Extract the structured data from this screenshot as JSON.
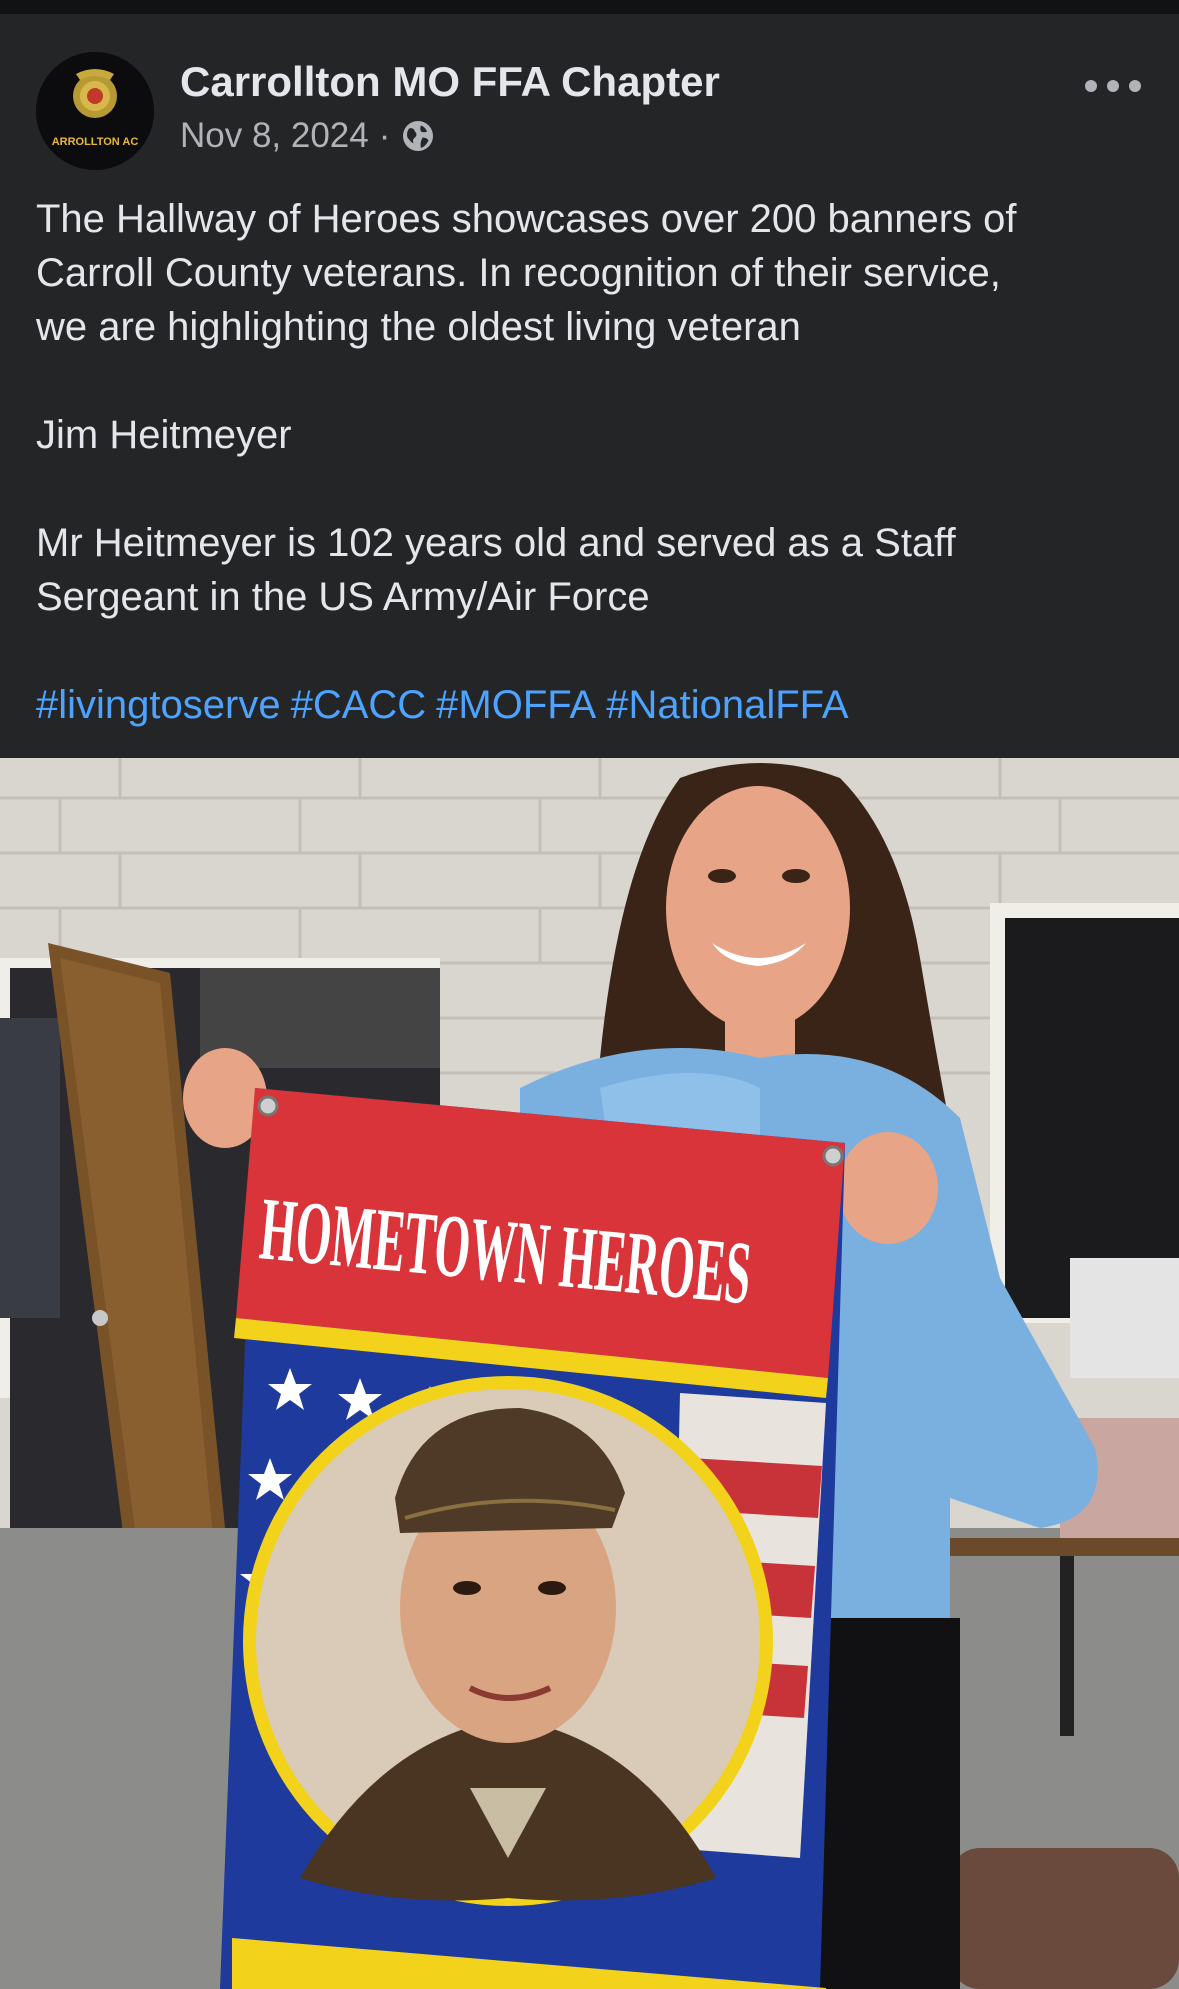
{
  "post": {
    "page_name": "Carrollton MO FFA Chapter",
    "date": "Nov 8, 2024",
    "separator": "·",
    "privacy_icon": "globe-icon",
    "more_icon": "more-horizontal-icon",
    "avatar_text": "ARROLLTON AC",
    "text_lines": [
      "The Hallway of Heroes showcases over 200 banners of",
      "Carroll County veterans. In recognition of their service,",
      "we are highlighting the oldest living veteran",
      "",
      "Jim Heitmeyer",
      "",
      "Mr Heitmeyer is 102 years old and served as a Staff",
      "Sergeant in the US Army/Air Force",
      ""
    ],
    "hashtags": [
      "#livingtoserve",
      "#CACC",
      "#MOFFA",
      "#NationalFFA"
    ]
  },
  "photo": {
    "banner_title": "HOMETOWN HEROES"
  },
  "colors": {
    "background": "#242526",
    "text": "#e4e6eb",
    "secondary_text": "#b0b3b8",
    "link": "#4da3ff",
    "banner_red": "#d8343a",
    "banner_yellow": "#f2d21b",
    "banner_blue": "#1d3a9c"
  }
}
